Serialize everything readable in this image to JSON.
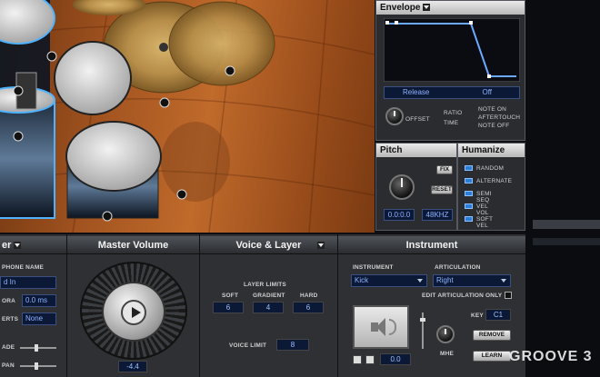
{
  "envelope": {
    "title": "Envelope",
    "mode": "Release",
    "value": "Off",
    "offset_label": "OFFSET",
    "ratio_label": "RATIO",
    "time_label": "TIME",
    "note_on": "NOTE ON",
    "aftertouch": "AFTERTOUCH",
    "note_off": "NOTE OFF"
  },
  "pitch": {
    "title": "Pitch",
    "fix": "FIX",
    "reset": "RESET",
    "value": "0.0:0.0",
    "rate": "48KHZ"
  },
  "humanize": {
    "title": "Humanize",
    "options": [
      "RANDOM",
      "ALTERNATE",
      "SEMI SEQ",
      "VEL VOL",
      "SOFT VEL"
    ]
  },
  "left_panel": {
    "title": "er",
    "mic_label": "PHONE NAME",
    "mic_value": "d In",
    "delay_label": "ORA",
    "delay_value": "0.0 ms",
    "effects_label": "ERTS",
    "effects_value": "None",
    "fade_label": "ADE",
    "pan_label": "PAN"
  },
  "master": {
    "title": "Master Volume",
    "value": "-4.4"
  },
  "voice": {
    "title": "Voice & Layer",
    "layer_limits": "LAYER LIMITS",
    "soft": "SOFT",
    "gradient": "GRADIENT",
    "hard": "HARD",
    "soft_val": "6",
    "gradient_val": "4",
    "hard_val": "6",
    "voice_limit_label": "VOICE LIMIT",
    "voice_limit_val": "8"
  },
  "instrument": {
    "title": "Instrument",
    "instrument_label": "INSTRUMENT",
    "instrument_value": "Kick",
    "articulation_label": "ARTICULATION",
    "articulation_value": "Right",
    "edit_articulation": "EDIT ARTICULATION ONLY",
    "key_label": "KEY",
    "key_value": "C1",
    "remove": "REMOVE",
    "learn": "LEARN",
    "mute": "MHE",
    "pitch_value": "0.0"
  },
  "logo": "GROOVE 3"
}
